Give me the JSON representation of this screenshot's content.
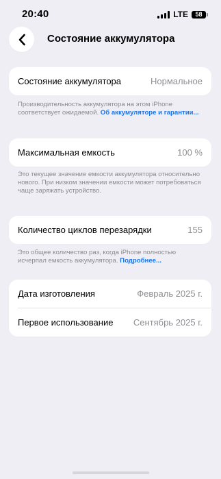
{
  "status_bar": {
    "time": "20:40",
    "network": "LTE",
    "battery_level": "58"
  },
  "nav": {
    "title": "Состояние аккумулятора"
  },
  "battery_health": {
    "label": "Состояние аккумулятора",
    "value": "Нормальное",
    "note_text": "Производительность аккумулятора на этом iPhone соответствует ожидаемой. ",
    "note_link": "Об аккумуляторе и гарантии..."
  },
  "max_capacity": {
    "label": "Максимальная емкость",
    "value": "100 %",
    "note_text": "Это текущее значение емкости аккумулятора относительно нового. При низком значении емкости может потребоваться чаще заряжать устройство."
  },
  "cycle_count": {
    "label": "Количество циклов перезарядки",
    "value": "155",
    "note_text": "Это общее количество раз, когда iPhone полностью исчерпал емкость аккумулятора. ",
    "note_link": "Подробнее..."
  },
  "dates": {
    "manufacture_label": "Дата изготовления",
    "manufacture_value": "Февраль 2025 г.",
    "first_use_label": "Первое использование",
    "first_use_value": "Сентябрь 2025 г."
  }
}
